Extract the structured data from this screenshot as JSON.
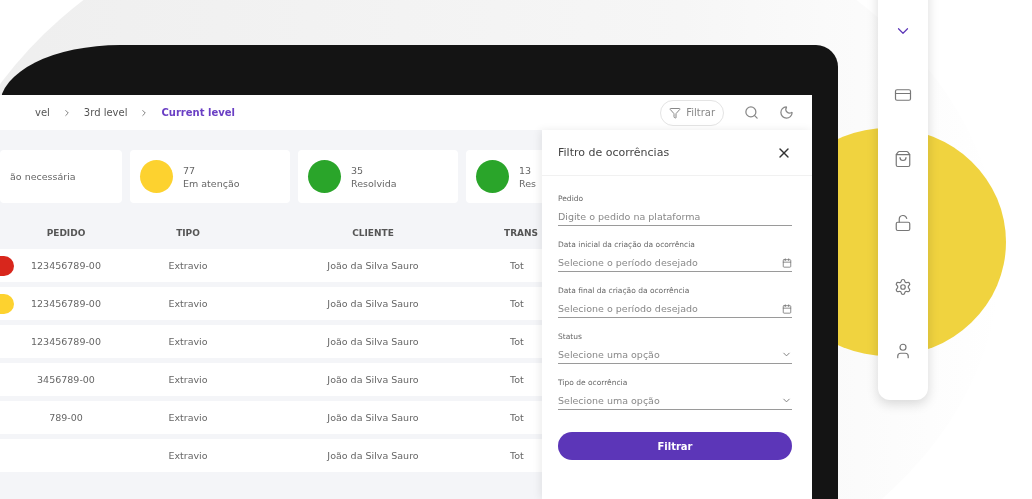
{
  "breadcrumb": [
    {
      "label": "vel",
      "current": false
    },
    {
      "label": "3rd level",
      "current": false
    },
    {
      "label": "Current level",
      "current": true
    }
  ],
  "toolbar": {
    "filter_button": "Filtrar"
  },
  "summary_cards": [
    {
      "label": "ão necessária"
    },
    {
      "count": "77",
      "label": "Em atenção",
      "color": "#fdd22f"
    },
    {
      "count": "35",
      "label": "Resolvida",
      "color": "#2aa52a"
    },
    {
      "count": "13",
      "label": "Res",
      "color": "#2aa52a"
    }
  ],
  "table": {
    "columns": [
      "PEDIDO",
      "TIPO",
      "CLIENTE",
      "TRANS"
    ],
    "rows": [
      {
        "color": "#d8261c",
        "cells": [
          "123456789-00",
          "Extravio",
          "João da Silva Sauro",
          "Tot"
        ]
      },
      {
        "color": "#fdd22f",
        "cells": [
          "123456789-00",
          "Extravio",
          "João da Silva Sauro",
          "Tot"
        ]
      },
      {
        "cells": [
          "123456789-00",
          "Extravio",
          "João da Silva Sauro",
          "Tot"
        ]
      },
      {
        "cells": [
          "3456789-00",
          "Extravio",
          "João da Silva Sauro",
          "Tot"
        ]
      },
      {
        "cells": [
          "789-00",
          "Extravio",
          "João da Silva Sauro",
          "Tot"
        ]
      },
      {
        "cells": [
          "",
          "Extravio",
          "João da Silva Sauro",
          "Tot"
        ]
      }
    ]
  },
  "filter_panel": {
    "title": "Filtro de ocorrências",
    "fields": [
      {
        "kind": "text",
        "label": "Pedido",
        "placeholder": "Digite o pedido na plataforma"
      },
      {
        "kind": "date",
        "label": "Data inicial da criação da ocorrência",
        "placeholder": "Selecione o período desejado"
      },
      {
        "kind": "date",
        "label": "Data final da criação da ocorrência",
        "placeholder": "Selecione o período desejado"
      },
      {
        "kind": "select",
        "label": "Status",
        "placeholder": "Selecione uma opção"
      },
      {
        "kind": "select",
        "label": "Tipo de ocorrência",
        "placeholder": "Selecione uma opção"
      }
    ],
    "submit": "Filtrar"
  },
  "side_nav": [
    {
      "kind": "chevron",
      "selected": true
    },
    {
      "kind": "card",
      "selected": false
    },
    {
      "kind": "bag",
      "selected": false
    },
    {
      "kind": "lock",
      "selected": false
    },
    {
      "kind": "gear",
      "selected": false
    },
    {
      "kind": "user",
      "selected": false
    }
  ]
}
